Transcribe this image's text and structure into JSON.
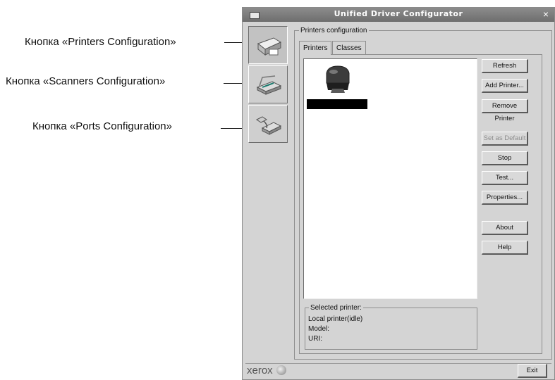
{
  "callouts": [
    {
      "label": "Кнопка «Printers Configuration»"
    },
    {
      "label": "Кнопка «Scanners Configuration»"
    },
    {
      "label": "Кнопка «Ports Configuration»"
    }
  ],
  "window": {
    "title": "Unified Driver Configurator",
    "close_glyph": "×"
  },
  "mode_buttons": [
    {
      "name": "printers-configuration",
      "icon": "printer-icon"
    },
    {
      "name": "scanners-configuration",
      "icon": "scanner-icon"
    },
    {
      "name": "ports-configuration",
      "icon": "port-icon"
    }
  ],
  "group_title": "Printers configuration",
  "tabs": [
    {
      "label": "Printers",
      "active": true
    },
    {
      "label": "Classes",
      "active": false
    }
  ],
  "printer_list": [
    {
      "label": "",
      "icon": "printer-icon"
    }
  ],
  "buttons": [
    {
      "label": "Refresh",
      "enabled": true
    },
    {
      "label": "Add Printer...",
      "enabled": true
    },
    {
      "label": "Remove Printer",
      "enabled": true
    },
    {
      "label": "Set as Default",
      "enabled": false
    },
    {
      "label": "Stop",
      "enabled": true
    },
    {
      "label": "Test...",
      "enabled": true
    },
    {
      "label": "Properties...",
      "enabled": true
    },
    {
      "label": "About",
      "enabled": true
    },
    {
      "label": "Help",
      "enabled": true
    }
  ],
  "selected_printer": {
    "title": "Selected printer:",
    "lines": [
      "Local printer(idle)",
      "Model:",
      "URI:"
    ]
  },
  "footer": {
    "brand": "xerox",
    "exit_label": "Exit"
  },
  "colors": {
    "callout_dot": "#1a7a6e",
    "window_bg": "#d4d4d4",
    "titlebar": "#7a7a7a"
  }
}
